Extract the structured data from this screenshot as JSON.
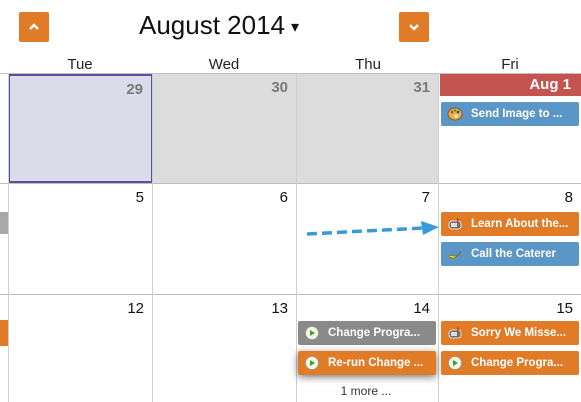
{
  "header": {
    "month_title": "August 2014",
    "caret": "▾"
  },
  "weekdays": [
    "Tue",
    "Wed",
    "Thu",
    "Fri"
  ],
  "days": {
    "r1": [
      "29",
      "30",
      "31",
      "Aug 1"
    ],
    "r2": [
      "5",
      "6",
      "7",
      "8"
    ],
    "r3": [
      "12",
      "13",
      "14",
      "15"
    ]
  },
  "events": {
    "aug1_1": "Send Image to ...",
    "aug8_1": "Learn About the...",
    "aug8_2": "Call the Caterer",
    "aug14_1": "Change Progra...",
    "aug14_2": "Re-run Change ...",
    "aug15_1": "Sorry We Misse...",
    "aug15_2": "Change Progra..."
  },
  "more_link": "1 more ...",
  "colors": {
    "accent_orange": "#e07b28",
    "event_blue": "#5a97c7",
    "event_gray": "#8a8a8a",
    "today_red": "#c4544f",
    "selected_fill": "#dcdbe9",
    "selected_border": "#5b4fa0",
    "arrow_blue": "#3a9ad9"
  }
}
